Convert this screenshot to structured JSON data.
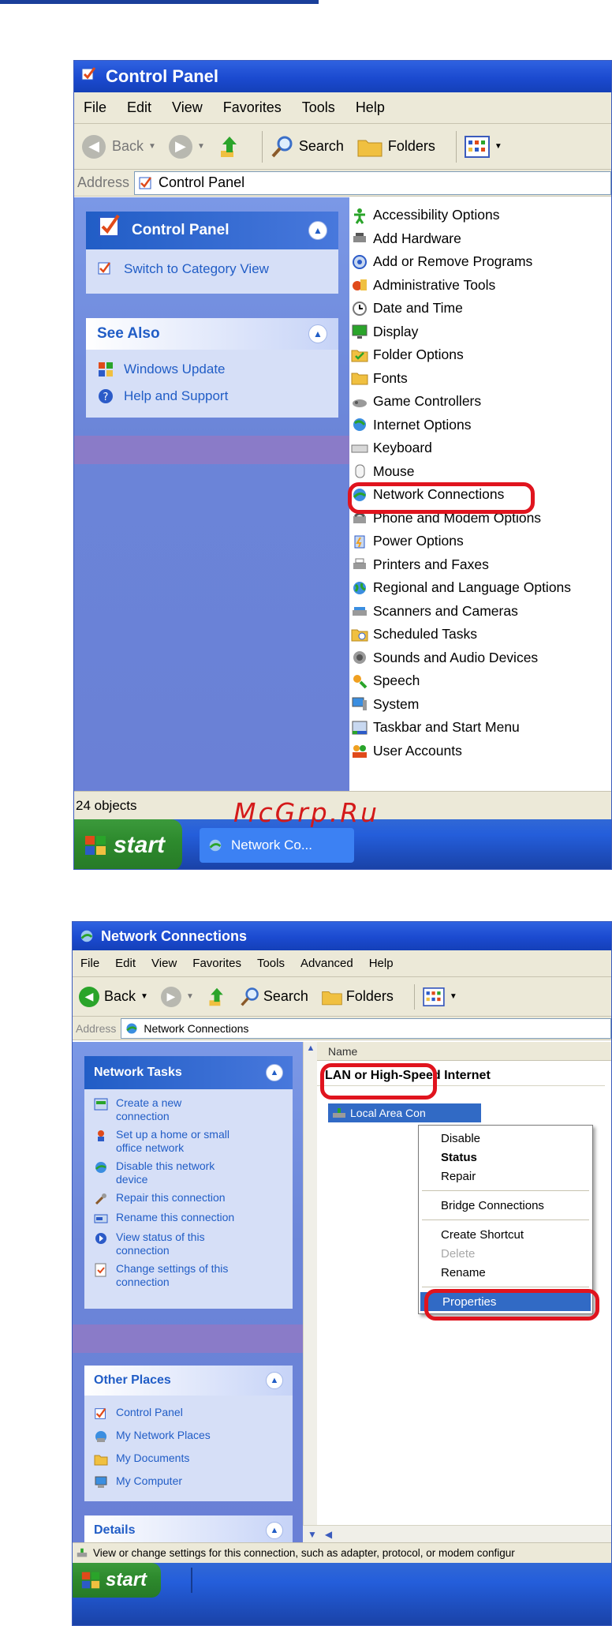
{
  "window1": {
    "title": "Control Panel",
    "menu": [
      "File",
      "Edit",
      "View",
      "Favorites",
      "Tools",
      "Help"
    ],
    "toolbar": {
      "back": "Back",
      "search": "Search",
      "folders": "Folders"
    },
    "address_label": "Address",
    "address_value": "Control Panel",
    "left_pane": {
      "control_panel_title": "Control Panel",
      "switch_view": "Switch to Category View",
      "see_also_title": "See Also",
      "see_also_items": [
        "Windows Update",
        "Help and Support"
      ]
    },
    "items": [
      "Accessibility Options",
      "Add Hardware",
      "Add or Remove Programs",
      "Administrative Tools",
      "Date and Time",
      "Display",
      "Folder Options",
      "Fonts",
      "Game Controllers",
      "Internet Options",
      "Keyboard",
      "Mouse",
      "Network Connections",
      "Phone and Modem Options",
      "Power Options",
      "Printers and Faxes",
      "Regional and Language Options",
      "Scanners and Cameras",
      "Scheduled Tasks",
      "Sounds and Audio Devices",
      "Speech",
      "System",
      "Taskbar and Start Menu",
      "User Accounts"
    ],
    "status": "24 objects",
    "taskbar": {
      "start": "start",
      "app": "Network Co..."
    }
  },
  "watermark": "McGrp.Ru",
  "window2": {
    "title": "Network Connections",
    "menu": [
      "File",
      "Edit",
      "View",
      "Favorites",
      "Tools",
      "Advanced",
      "Help"
    ],
    "toolbar": {
      "back": "Back",
      "search": "Search",
      "folders": "Folders"
    },
    "address_label": "Address",
    "address_value": "Network Connections",
    "network_tasks_title": "Network Tasks",
    "network_tasks": [
      [
        "Create a new",
        "connection"
      ],
      [
        "Set up a home or small",
        "office network"
      ],
      [
        "Disable this network",
        "device"
      ],
      [
        "Repair this connection",
        ""
      ],
      [
        "Rename this connection",
        ""
      ],
      [
        "View status of this",
        "connection"
      ],
      [
        "Change settings of this",
        "connection"
      ]
    ],
    "other_places_title": "Other Places",
    "other_places": [
      "Control Panel",
      "My Network Places",
      "My Documents",
      "My Computer"
    ],
    "details_title": "Details",
    "column_name": "Name",
    "group_label": "LAN or High-Speed Internet",
    "connection_label": "Local Area Con",
    "context_menu": {
      "disable": "Disable",
      "status": "Status",
      "repair": "Repair",
      "bridge": "Bridge Connections",
      "shortcut": "Create Shortcut",
      "delete": "Delete",
      "rename": "Rename",
      "properties": "Properties"
    },
    "status": "View or change settings for this connection, such as adapter, protocol, or modem configur",
    "taskbar": {
      "start": "start"
    }
  },
  "colors": {
    "accent": "#215dc6",
    "highlight": "#e0141e",
    "selection": "#316ac5"
  }
}
